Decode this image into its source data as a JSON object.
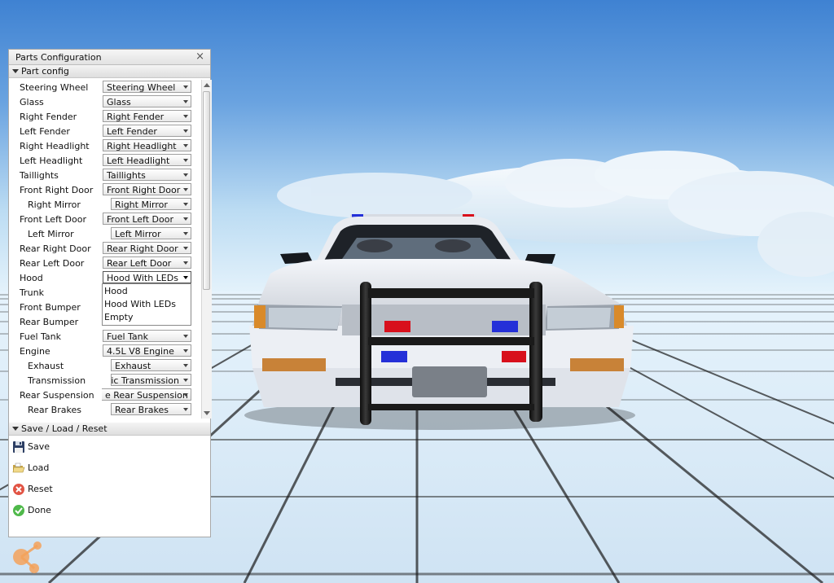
{
  "panel": {
    "title": "Parts Configuration",
    "close_glyph": "×",
    "part_config_header": "Part config",
    "save_section_header": "Save / Load / Reset"
  },
  "parts": [
    {
      "label": "Steering Wheel",
      "value": "Steering Wheel",
      "indent": 1
    },
    {
      "label": "Glass",
      "value": "Glass",
      "indent": 1
    },
    {
      "label": "Right Fender",
      "value": "Right Fender",
      "indent": 1
    },
    {
      "label": "Left Fender",
      "value": "Left Fender",
      "indent": 1
    },
    {
      "label": "Right Headlight",
      "value": "Right Headlight",
      "indent": 1
    },
    {
      "label": "Left Headlight",
      "value": "Left Headlight",
      "indent": 1
    },
    {
      "label": "Taillights",
      "value": "Taillights",
      "indent": 1
    },
    {
      "label": "Front Right Door",
      "value": "Front Right Door",
      "indent": 1
    },
    {
      "label": "Right Mirror",
      "value": "Right Mirror",
      "indent": 2
    },
    {
      "label": "Front Left Door",
      "value": "Front Left Door",
      "indent": 1
    },
    {
      "label": "Left Mirror",
      "value": "Left Mirror",
      "indent": 2
    },
    {
      "label": "Rear Right Door",
      "value": "Rear Right Door",
      "indent": 1
    },
    {
      "label": "Rear Left Door",
      "value": "Rear Left Door",
      "indent": 1
    },
    {
      "label": "Hood",
      "value": "Hood With LEDs",
      "indent": 1,
      "open": true
    },
    {
      "label": "Trunk",
      "value": "",
      "indent": 1,
      "hidden": true
    },
    {
      "label": "Front Bumper",
      "value": "",
      "indent": 1,
      "hidden": true
    },
    {
      "label": "Rear Bumper",
      "value": "",
      "indent": 1,
      "hidden": true
    },
    {
      "label": "Fuel Tank",
      "value": "Fuel Tank",
      "indent": 1
    },
    {
      "label": "Engine",
      "value": "4.5L V8 Engine",
      "indent": 1
    },
    {
      "label": "Exhaust",
      "value": "Exhaust",
      "indent": 2
    },
    {
      "label": "Transmission",
      "value": "tic Transmission",
      "indent": 2
    },
    {
      "label": "Rear Suspension",
      "value": "e Rear Suspension",
      "indent": 1
    },
    {
      "label": "Rear Brakes",
      "value": "Rear Brakes",
      "indent": 2
    }
  ],
  "hood_options": [
    "Hood",
    "Hood With LEDs",
    "Empty"
  ],
  "actions": [
    {
      "label": "Save",
      "icon": "floppy-disk-icon"
    },
    {
      "label": "Load",
      "icon": "folder-open-icon"
    },
    {
      "label": "Reset",
      "icon": "red-x-circle-icon"
    },
    {
      "label": "Done",
      "icon": "green-check-circle-icon"
    }
  ],
  "colors": {
    "sky_top": "#3f82d2",
    "sky_horizon": "#d8ecf8",
    "grid_floor": "#e6f2fb",
    "grid_line": "#1a1a1a",
    "car_body": "#eef0f4",
    "push_bar": "#181818",
    "red_led": "#d8101c",
    "blue_led": "#2430d8",
    "logo_orange": "#f4a25a"
  }
}
